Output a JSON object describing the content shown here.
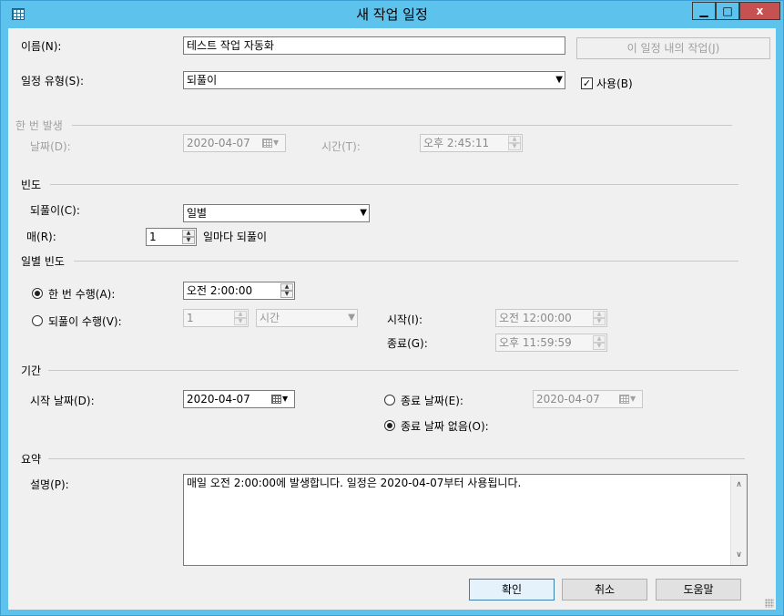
{
  "window": {
    "title": "새 작업 일정",
    "min": "▁",
    "max": "□",
    "close": "x"
  },
  "name": {
    "label": "이름(N):",
    "value": "테스트 작업 자동화",
    "jobs_button": "이 일정 내의 작업(J)"
  },
  "schedule_type": {
    "label": "일정 유형(S):",
    "value": "되풀이",
    "enabled_label": "사용(B)",
    "enabled_checked": true
  },
  "one_time": {
    "group": "한 번 발생",
    "date_label": "날짜(D):",
    "date": "2020-04-07",
    "time_label": "시간(T):",
    "time": "오후  2:45:11"
  },
  "frequency": {
    "group": "빈도",
    "occurs_label": "되풀이(C):",
    "occurs": "일별",
    "every_label": "매(R):",
    "every": "1",
    "every_suffix": "일마다 되풀이"
  },
  "daily": {
    "group": "일별 빈도",
    "once_label": "한 번 수행(A):",
    "once_time": "오전  2:00:00",
    "once_selected": true,
    "every_label": "되풀이 수행(V):",
    "every_value": "1",
    "every_unit": "시간",
    "start_label": "시작(I):",
    "start_time": "오전 12:00:00",
    "end_label": "종료(G):",
    "end_time": "오후 11:59:59"
  },
  "duration": {
    "group": "기간",
    "start_label": "시작 날짜(D):",
    "start_date": "2020-04-07",
    "end_label": "종료 날짜(E):",
    "end_date": "2020-04-07",
    "no_end_label": "종료 날짜 없음(O):",
    "no_end_selected": true
  },
  "summary": {
    "group": "요약",
    "desc_label": "설명(P):",
    "description": "매일 오전 2:00:00에 발생합니다. 일정은 2020-04-07부터 사용됩니다."
  },
  "buttons": {
    "ok": "확인",
    "cancel": "취소",
    "help": "도움말"
  },
  "colors": {
    "titlebar": "#5ec3ec",
    "close": "#c75050",
    "dialog_bg": "#f0f0f0"
  }
}
